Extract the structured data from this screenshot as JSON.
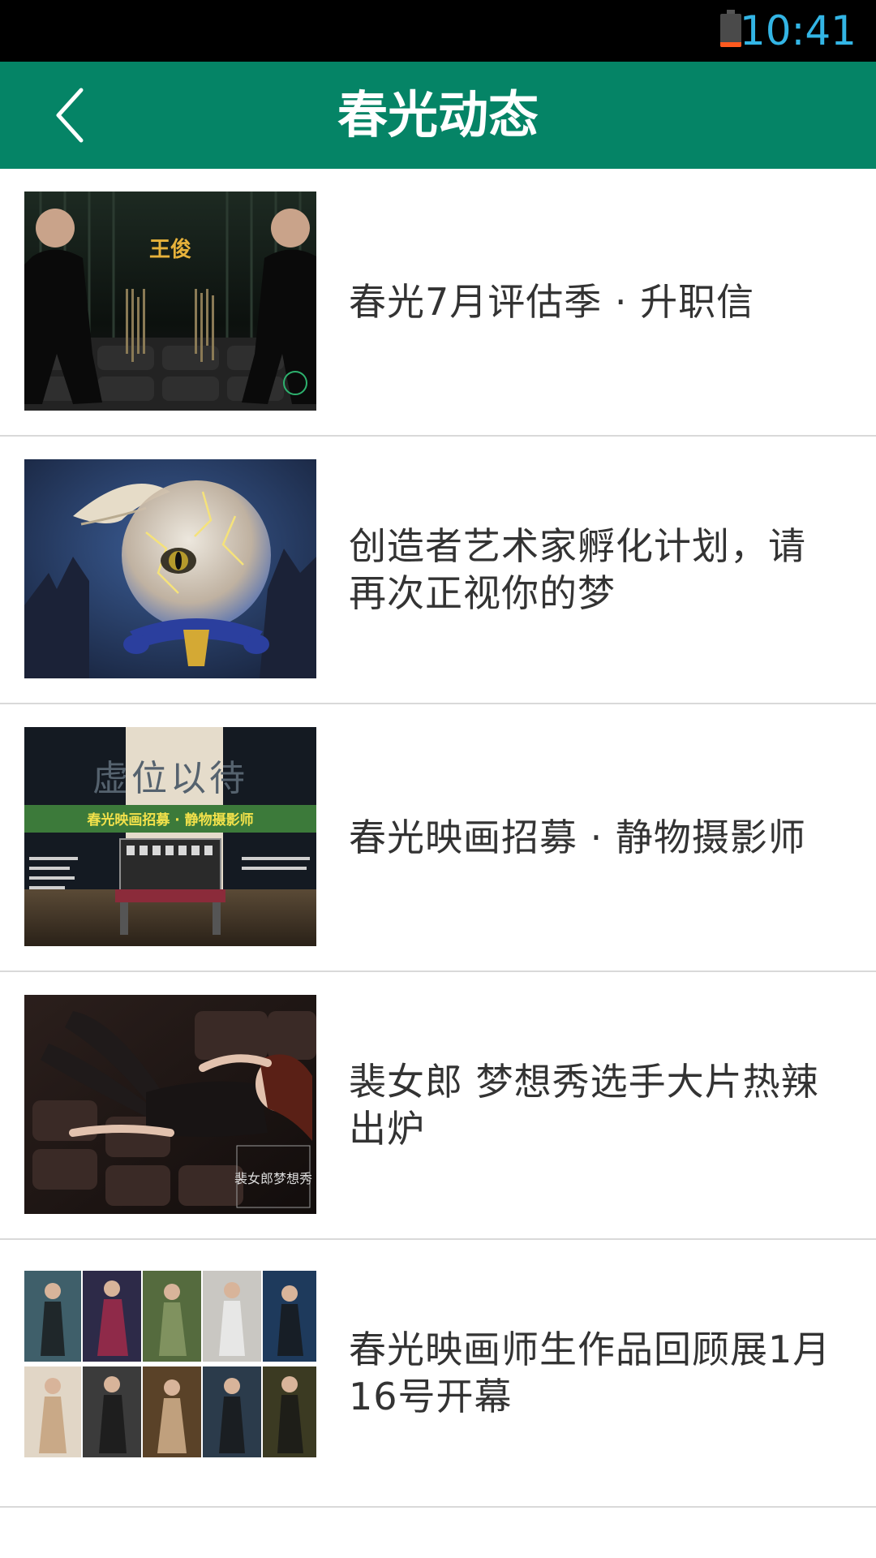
{
  "status_bar": {
    "time": "10:41",
    "battery_level": 0.15
  },
  "app_bar": {
    "title": "春光动态"
  },
  "news": [
    {
      "title": "春光7月评估季 · 升职信",
      "thumbnail_text": "王俊"
    },
    {
      "title": "创造者艺术家孵化计划，请再次正视你的梦"
    },
    {
      "title": "春光映画招募 · 静物摄影师",
      "thumbnail_text": "虚位以待",
      "thumbnail_banner": "春光映画招募 · 静物摄影师"
    },
    {
      "title": "裴女郎 梦想秀选手大片热辣出炉",
      "thumbnail_text": "裴女郎梦想秀"
    },
    {
      "title": "春光映画师生作品回顾展1月16号开幕"
    }
  ],
  "colors": {
    "app_bar": "#058466",
    "status_bar": "#000000",
    "clock": "#33b5e5",
    "battery_level": "#ff5a1f",
    "title_text": "#333333",
    "divider": "#d9d9d9"
  }
}
